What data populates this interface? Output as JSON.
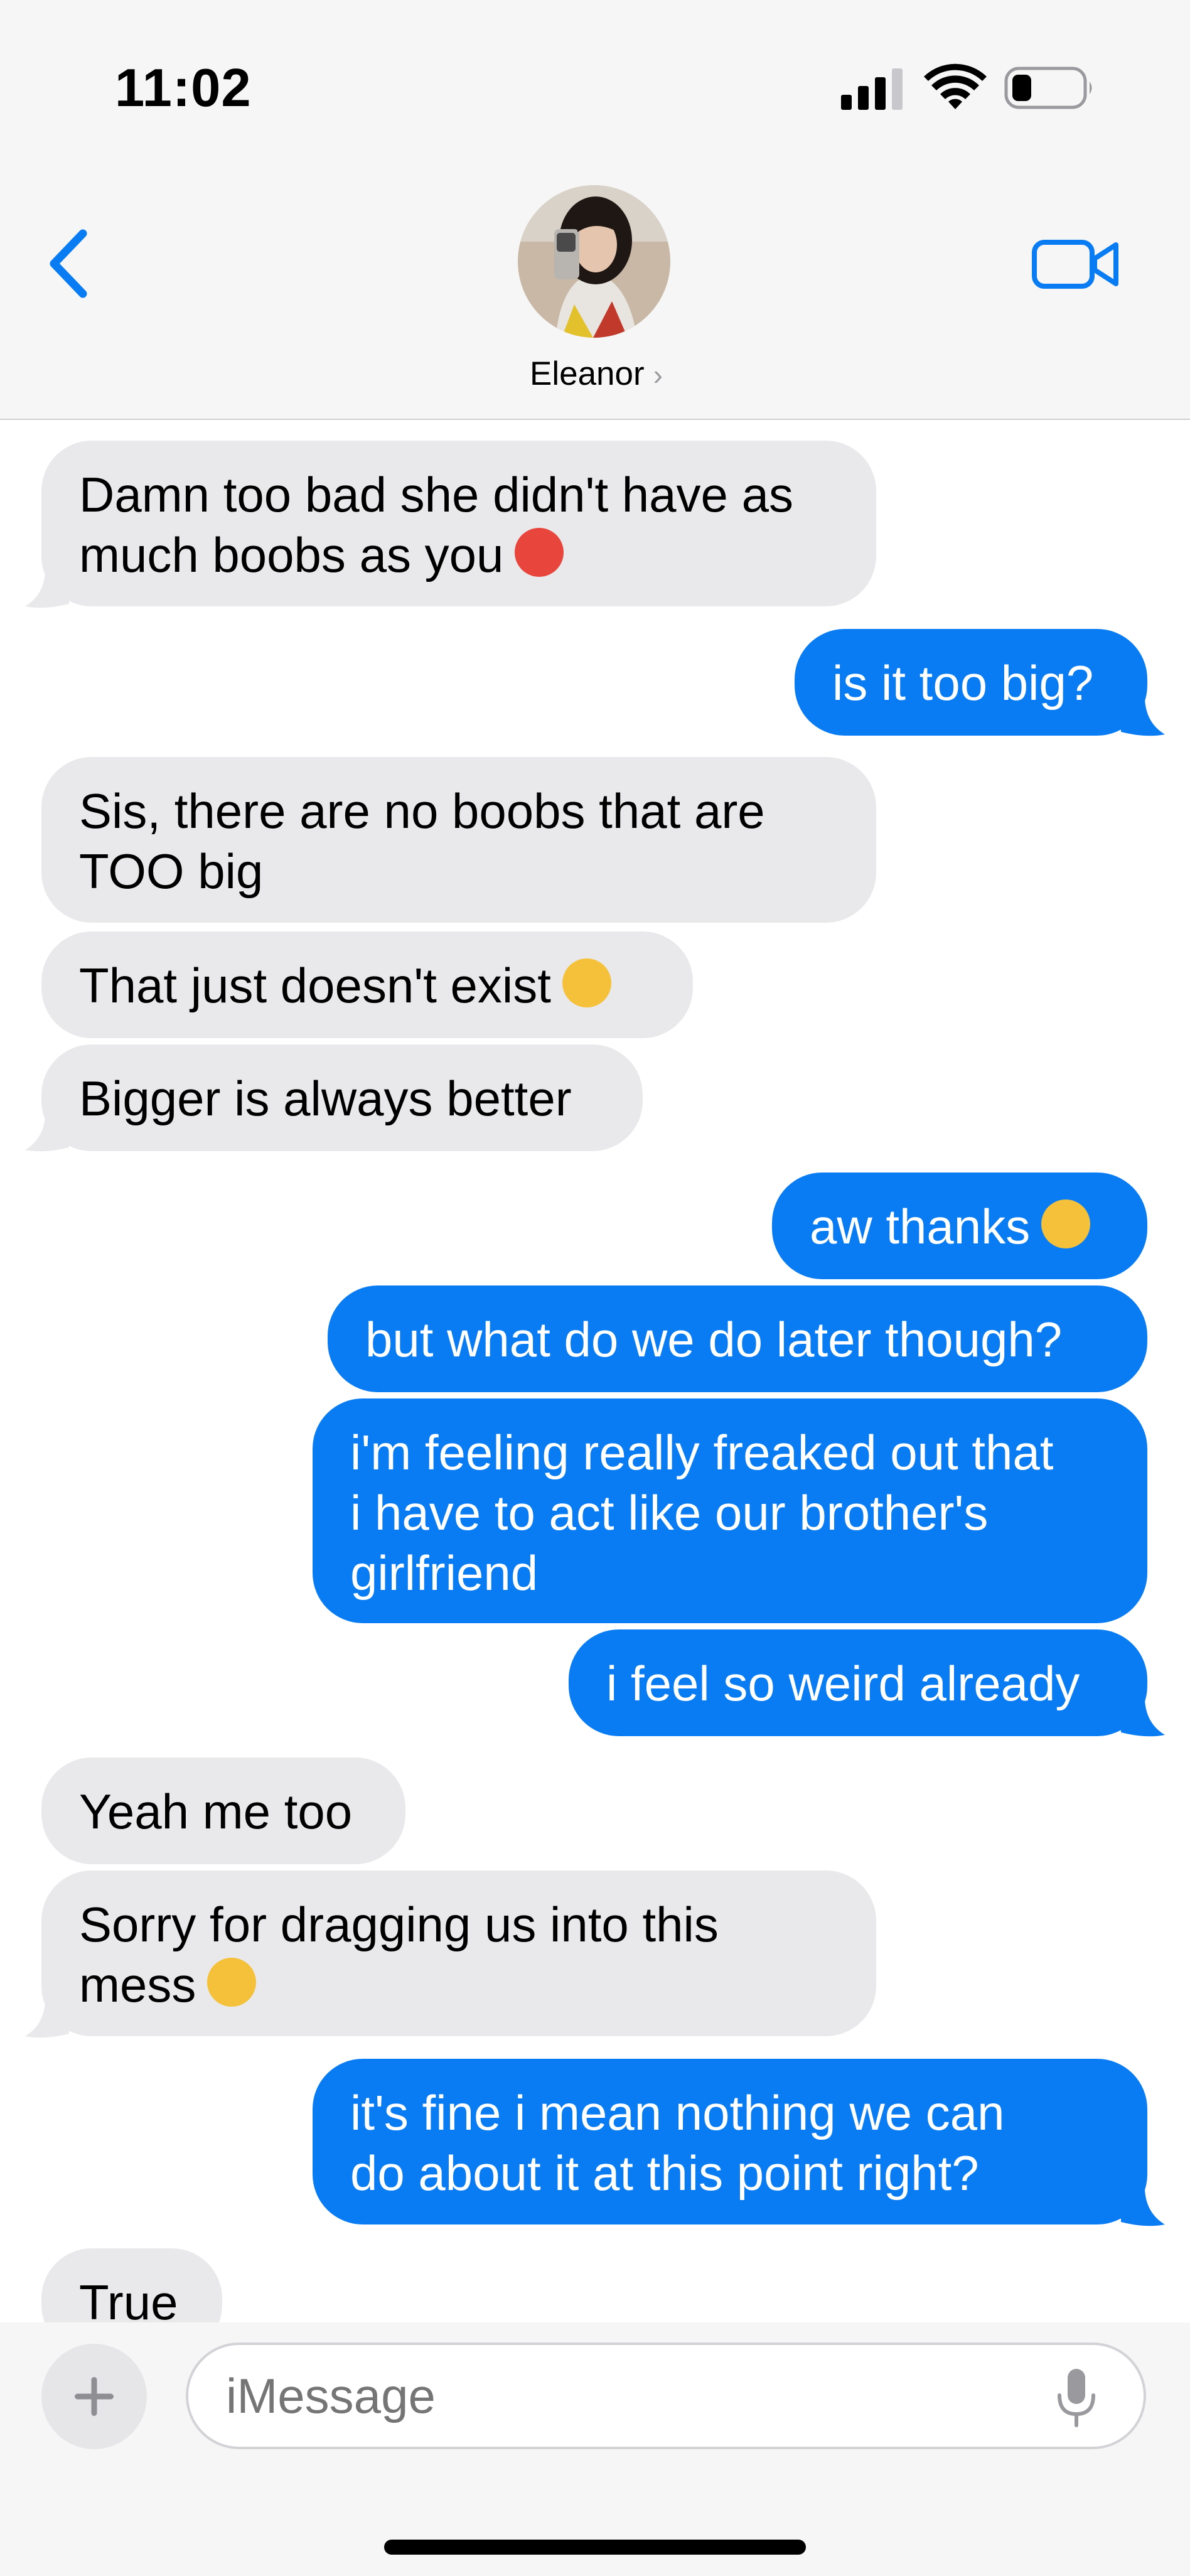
{
  "status_bar": {
    "time": "11:02"
  },
  "header": {
    "contact_name": "Eleanor",
    "chevron": "›"
  },
  "messages": [
    {
      "from": "them",
      "text": "Damn too bad she didn't have as",
      "text2": "much boobs as you"
    },
    {
      "from": "me",
      "text": "is it too big?"
    },
    {
      "from": "them",
      "text": "Sis, there are no boobs that are",
      "text2": "TOO big"
    },
    {
      "from": "them",
      "text": "That just doesn't exist"
    },
    {
      "from": "them",
      "text": "Bigger is always better"
    },
    {
      "from": "me",
      "text": "aw thanks"
    },
    {
      "from": "me",
      "text": "but what do we do later though?"
    },
    {
      "from": "me",
      "text": "i'm feeling really freaked out that",
      "text2": "i have to act like our brother's",
      "text3": "girlfriend"
    },
    {
      "from": "me",
      "text": "i feel so weird already"
    },
    {
      "from": "them",
      "text": "Yeah me too"
    },
    {
      "from": "them",
      "text": "Sorry for dragging us into this",
      "text2": "mess"
    },
    {
      "from": "me",
      "text": "it's fine i mean nothing we can",
      "text2": "do about it at this point right?"
    },
    {
      "from": "them",
      "text": "True"
    }
  ],
  "input": {
    "placeholder": "iMessage"
  },
  "colors": {
    "outgoing": "#0a7cf3",
    "incoming": "#e9e9eb",
    "accent": "#0a7cf3"
  },
  "icons": [
    "back-chevron-icon",
    "video-camera-icon",
    "plus-icon",
    "microphone-icon",
    "signal-icon",
    "wifi-icon",
    "battery-icon"
  ]
}
